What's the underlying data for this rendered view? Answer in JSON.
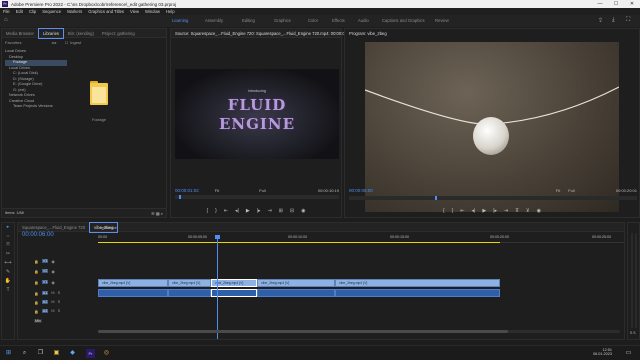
{
  "window": {
    "app_logo": "Pr",
    "title": "Adobe Premiere Pro 2022 - C:\\ns Dropbox\\cobr\\reference\\_edit gathering 03.prproj",
    "buttons": [
      "—",
      "☐",
      "✕"
    ]
  },
  "menu": [
    "File",
    "Edit",
    "Clip",
    "Sequence",
    "Markers",
    "Graphics and Titles",
    "View",
    "Window",
    "Help"
  ],
  "workspaces": {
    "home_icon": "home-icon",
    "items": [
      "Learning",
      "Assembly",
      "Editing",
      "Graphics",
      "Color",
      "Effects",
      "Audio",
      "Captions and Graphics",
      "Review"
    ],
    "active": "Learning"
  },
  "project_panel": {
    "tabs": [
      "Media Browser",
      "Libraries",
      "Bin: (sending)",
      "Project: gathering"
    ],
    "active_tab": "Libraries",
    "favorites_label": "Favorites",
    "ingest_label": "Ingest",
    "tree_header": "Local Drives",
    "tree_items": [
      "Desktop",
      "Footage",
      "Local Drives",
      "C: (Local Disk)",
      "D: (Storage)",
      "E: (Google Drive)",
      "G: (ext)",
      "Network Drives",
      "Creative Cloud",
      "Team Projects Versions"
    ],
    "selected_item": "Footage",
    "folder_name": "Footage",
    "footer_count": "Items: 1/88"
  },
  "source_monitor": {
    "tab_label": "Source: Squarespace_...Fluid_Engine 720: Squarespace_...Fluid_Engine 720.mp4: 00:00:05:12",
    "overlay_small": "Introducing",
    "overlay_line1": "FLUID",
    "overlay_line2": "ENGINE",
    "timecode_in": "00:00:01:02",
    "fit": "Fit",
    "quality": "Full",
    "duration": "00:00:10:19"
  },
  "program_monitor": {
    "tab_label": "Program: vibe_2beg",
    "timecode": "00:00:06:00",
    "fit": "Fit",
    "quality": "Full",
    "duration": "00:00:20:01"
  },
  "tools": [
    "▸",
    "⇔",
    "⤧",
    "✂",
    "⟷",
    "✎",
    "✋",
    "T"
  ],
  "timeline": {
    "tabs": [
      "Squarespace_...Fluid_Engine 720",
      "vibe_2beg"
    ],
    "left_tab": "reference",
    "active_tab": "vibe_2beg",
    "timecode": "00:00:06:00",
    "ruler": [
      "00:00",
      "00:00:05:00",
      "00:00:10:00",
      "00:00:15:00",
      "00:00:20:00",
      "00:00:25:00"
    ],
    "tracks_video": [
      "V3",
      "V2",
      "V1"
    ],
    "tracks_audio": [
      "A1",
      "A2",
      "A3"
    ],
    "master": "Mix",
    "clips": [
      "vibe_2beg.mp4 [V]",
      "vibe_2beg.mp4 [V]",
      "vibe_2beg.mp4 [V]",
      "vibe_2beg.mp4 [V]",
      "vibe_2beg.mp4 [V]"
    ]
  },
  "taskbar": {
    "time": "12:51",
    "date": "06.01.2023"
  },
  "colors": {
    "accent": "#4d8df5",
    "clip_video": "#8fb2e4",
    "clip_audio": "#2f5fa8",
    "folder": "#f3c94b"
  }
}
